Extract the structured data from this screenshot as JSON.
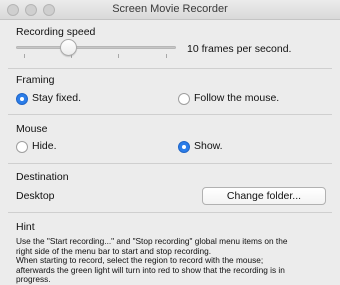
{
  "window": {
    "title": "Screen Movie Recorder"
  },
  "recording_speed": {
    "heading": "Recording speed",
    "value_text": "10 frames per second.",
    "level_fraction": 0.33
  },
  "framing": {
    "heading": "Framing",
    "options": [
      {
        "label": "Stay fixed.",
        "selected": true
      },
      {
        "label": "Follow the mouse.",
        "selected": false
      }
    ]
  },
  "mouse": {
    "heading": "Mouse",
    "options": [
      {
        "label": "Hide.",
        "selected": false
      },
      {
        "label": "Show.",
        "selected": true
      }
    ]
  },
  "destination": {
    "heading": "Destination",
    "folder": "Desktop",
    "button_label": "Change folder..."
  },
  "hint": {
    "heading": "Hint",
    "lines": [
      "Use the \"Start recording...\" and \"Stop recording\" global menu items on the",
      "right side of the menu bar to start and stop recording.",
      "When starting to record, select the region to record with the mouse;",
      "afterwards the green light will turn into red to show that the recording is in",
      "progress."
    ]
  },
  "colors": {
    "accent": "#2b7de9",
    "background": "#ececec"
  }
}
